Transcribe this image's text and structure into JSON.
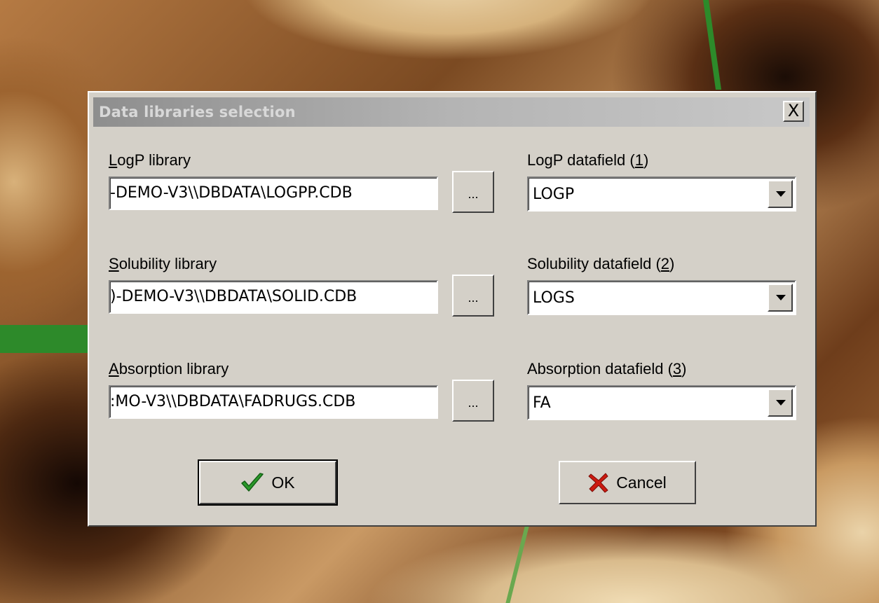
{
  "dialog": {
    "title": "Data libraries selection",
    "close_label": "X",
    "rows": [
      {
        "library_label": "LogP library",
        "library_access_key": "L",
        "library_path": "-DEMO-V3\\\\DBDATA\\LOGPP.CDB",
        "browse_label": "...",
        "datafield_label": "LogP datafield (1)",
        "datafield_access_key": "1",
        "datafield_value": "LOGP"
      },
      {
        "library_label": "Solubility library",
        "library_access_key": "S",
        "library_path": ")-DEMO-V3\\\\DBDATA\\SOLID.CDB",
        "browse_label": "...",
        "datafield_label": "Solubility datafield (2)",
        "datafield_access_key": "2",
        "datafield_value": "LOGS"
      },
      {
        "library_label": "Absorption library",
        "library_access_key": "A",
        "library_path": ":MO-V3\\\\DBDATA\\FADRUGS.CDB",
        "browse_label": "...",
        "datafield_label": "Absorption datafield (3)",
        "datafield_access_key": "3",
        "datafield_value": "FA"
      }
    ],
    "ok_label": "OK",
    "cancel_label": "Cancel"
  },
  "icons": {
    "ok_icon": "green-checkmark-icon",
    "cancel_icon": "red-x-icon",
    "close_icon": "close-icon",
    "dropdown_icon": "dropdown-arrow-icon"
  },
  "colors": {
    "dialog_face": "#d4d0c8",
    "title_gradient_start": "#8e8e8e",
    "title_gradient_end": "#c8c8c8",
    "ok_check": "#2a9a2a",
    "cancel_x": "#cc1a10"
  }
}
